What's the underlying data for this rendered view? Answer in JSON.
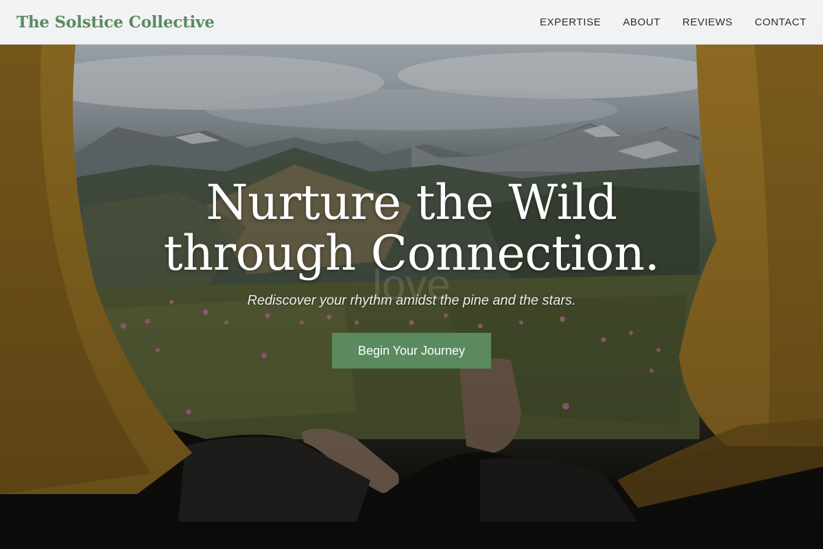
{
  "brand": {
    "name": "The Solstice Collective"
  },
  "nav": {
    "items": [
      {
        "label": "EXPERTISE"
      },
      {
        "label": "ABOUT"
      },
      {
        "label": "REVIEWS"
      },
      {
        "label": "CONTACT"
      }
    ]
  },
  "hero": {
    "title": "Nurture the Wild through Connection.",
    "faint_text": "love",
    "subtitle": "Rediscover your rhythm amidst the pine and the stars.",
    "cta_label": "Begin Your Journey",
    "image_icon": "tent-view-mountain-meadow-photo"
  },
  "colors": {
    "accent": "#5a8a5e",
    "nav_bg": "#f5f6f7",
    "nav_text": "#2b2b2b",
    "hero_text": "#ffffff"
  }
}
